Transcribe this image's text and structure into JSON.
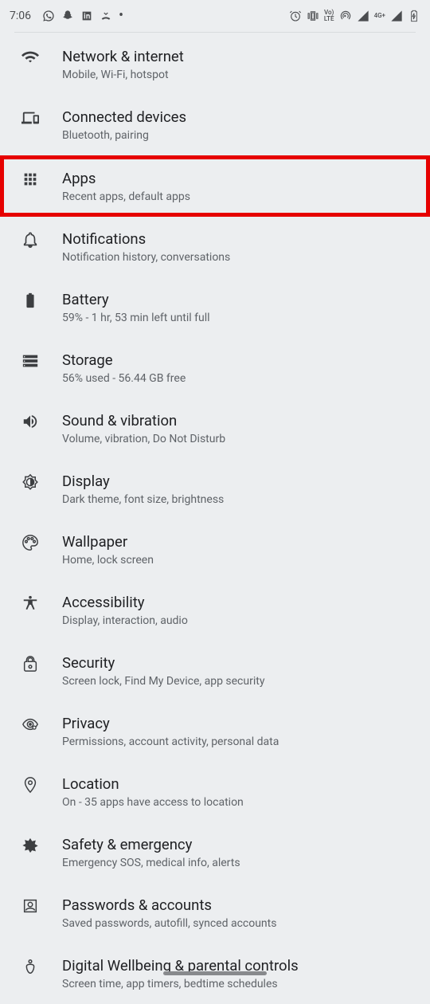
{
  "status": {
    "time": "7:06",
    "volte": "Vo)\nLTE",
    "network": "4G+"
  },
  "items": [
    {
      "title": "Network & internet",
      "subtitle": "Mobile, Wi-Fi, hotspot"
    },
    {
      "title": "Connected devices",
      "subtitle": "Bluetooth, pairing"
    },
    {
      "title": "Apps",
      "subtitle": "Recent apps, default apps"
    },
    {
      "title": "Notifications",
      "subtitle": "Notification history, conversations"
    },
    {
      "title": "Battery",
      "subtitle": "59% - 1 hr, 53 min left until full"
    },
    {
      "title": "Storage",
      "subtitle": "56% used - 56.44 GB free"
    },
    {
      "title": "Sound & vibration",
      "subtitle": "Volume, vibration, Do Not Disturb"
    },
    {
      "title": "Display",
      "subtitle": "Dark theme, font size, brightness"
    },
    {
      "title": "Wallpaper",
      "subtitle": "Home, lock screen"
    },
    {
      "title": "Accessibility",
      "subtitle": "Display, interaction, audio"
    },
    {
      "title": "Security",
      "subtitle": "Screen lock, Find My Device, app security"
    },
    {
      "title": "Privacy",
      "subtitle": "Permissions, account activity, personal data"
    },
    {
      "title": "Location",
      "subtitle": "On - 35 apps have access to location"
    },
    {
      "title": "Safety & emergency",
      "subtitle": "Emergency SOS, medical info, alerts"
    },
    {
      "title": "Passwords & accounts",
      "subtitle": "Saved passwords, autofill, synced accounts"
    },
    {
      "title": "Digital Wellbeing & parental controls",
      "subtitle": "Screen time, app timers, bedtime schedules"
    }
  ]
}
